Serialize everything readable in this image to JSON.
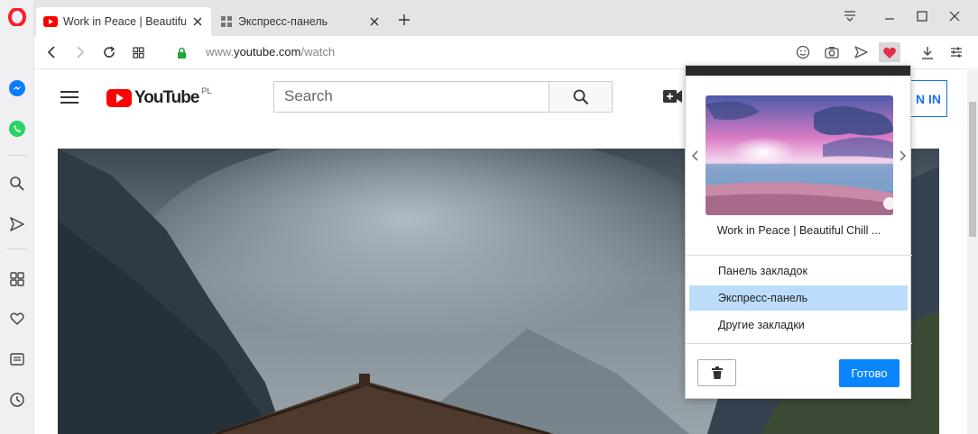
{
  "tabs": [
    {
      "title": "Work in Peace | Beautiful Chill Mix",
      "active": true,
      "icon": "youtube-icon"
    },
    {
      "title": "Экспресс-панель",
      "active": false,
      "icon": "speed-dial-icon"
    }
  ],
  "address": {
    "prefix": "www.",
    "host": "youtube.com",
    "path": "/watch"
  },
  "youtube": {
    "logo_text": "YouTube",
    "region": "PL",
    "search_placeholder": "Search",
    "signin_label": "N IN"
  },
  "popup": {
    "item_title": "Work in Peace | Beautiful Chill ...",
    "folders": [
      {
        "label": "Панель закладок",
        "selected": false
      },
      {
        "label": "Экспресс-панель",
        "selected": true
      },
      {
        "label": "Другие закладки",
        "selected": false
      }
    ],
    "done_label": "Готово"
  },
  "colors": {
    "opera_red": "#ff1b2d",
    "youtube_red": "#ff0000",
    "accent_blue": "#0a84ff",
    "selection": "#bcdcfb",
    "bookmark_heart": "#e0304a"
  }
}
